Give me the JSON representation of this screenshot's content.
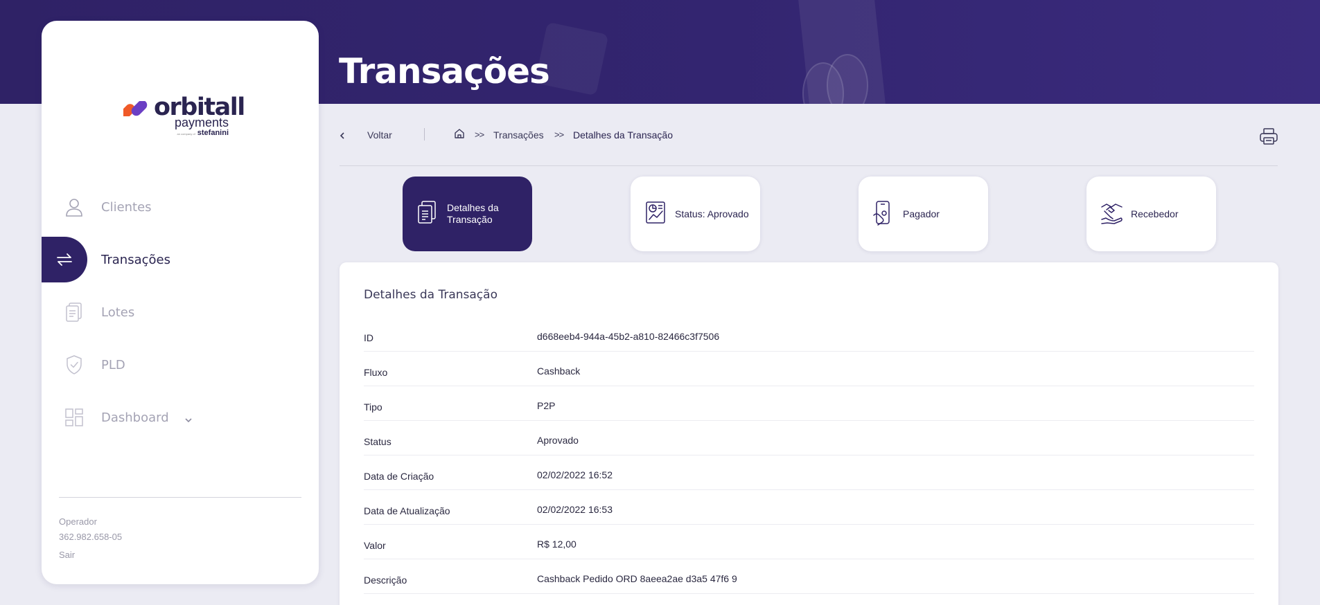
{
  "header": {
    "title": "Transações"
  },
  "sidebar": {
    "logo": {
      "main": "orbitall",
      "sub": "payments",
      "tag": "stefanini",
      "tag_small": "an company of"
    },
    "items": [
      {
        "label": "Clientes",
        "icon": "user-icon",
        "active": false
      },
      {
        "label": "Transações",
        "icon": "transfer-arrows-icon",
        "active": true
      },
      {
        "label": "Lotes",
        "icon": "documents-icon",
        "active": false
      },
      {
        "label": "PLD",
        "icon": "shield-check-icon",
        "active": false
      },
      {
        "label": "Dashboard",
        "icon": "dashboard-grid-icon",
        "active": false
      }
    ],
    "operator_label": "Operador",
    "operator_value": "362.982.658-05",
    "logout": "Sair"
  },
  "breadcrumb": {
    "back": "Voltar",
    "separator": ">>",
    "items": [
      "Transações",
      "Detalhes da Transação"
    ]
  },
  "tabs": [
    {
      "label": "Detalhes da Transação",
      "icon": "document-list-icon",
      "active": true
    },
    {
      "label": "Status: Aprovado",
      "icon": "status-chart-icon",
      "active": false
    },
    {
      "label": "Pagador",
      "icon": "phone-hand-icon",
      "active": false
    },
    {
      "label": "Recebedor",
      "icon": "handshake-icon",
      "active": false
    }
  ],
  "details": {
    "title": "Detalhes da Transação",
    "rows": [
      {
        "key": "ID",
        "value": "d668eeb4-944a-45b2-a810-82466c3f7506"
      },
      {
        "key": "Fluxo",
        "value": "Cashback"
      },
      {
        "key": "Tipo",
        "value": "P2P"
      },
      {
        "key": "Status",
        "value": "Aprovado"
      },
      {
        "key": "Data de Criação",
        "value": "02/02/2022 16:52"
      },
      {
        "key": "Data de Atualização",
        "value": "02/02/2022 16:53"
      },
      {
        "key": "Valor",
        "value": "R$ 12,00"
      },
      {
        "key": "Descrição",
        "value": "Cashback Pedido ORD 8aeea2ae d3a5 47f6 9"
      }
    ]
  },
  "colors": {
    "primary": "#2f2266",
    "background": "#ebebf3",
    "muted": "#a4a3b4"
  }
}
